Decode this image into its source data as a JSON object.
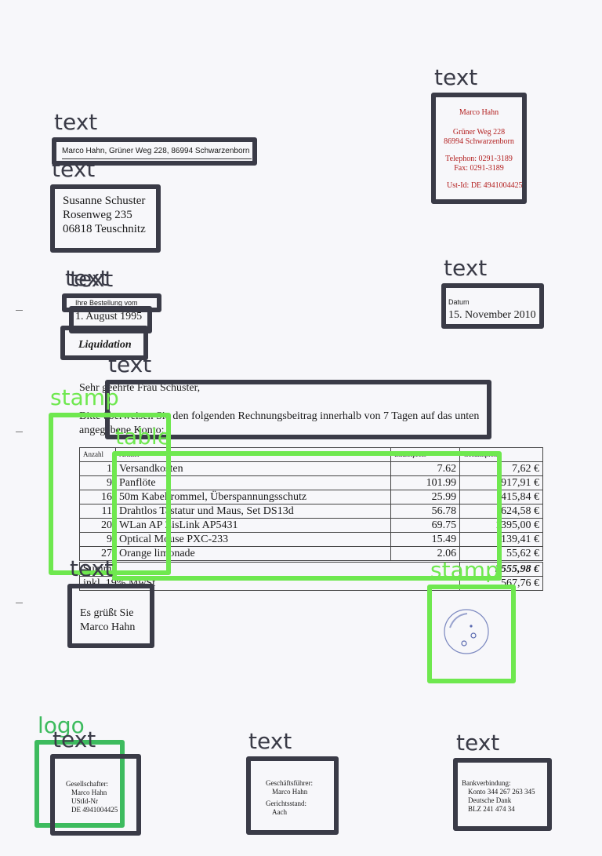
{
  "sender_line": "Marco Hahn, Grüner Weg 228, 86994 Schwarzenborn",
  "letterhead": {
    "name": "Marco Hahn",
    "street": "Grüner Weg 228",
    "city": "86994 Schwarzenborn",
    "phone": "Telephon:  0291-3189",
    "fax": "Fax:  0291-3189",
    "ustid": "Ust-Id: DE 4941004425"
  },
  "recipient": {
    "name": "Susanne Schuster",
    "street": "Rosenweg 235",
    "city": "06818 Teuschnitz"
  },
  "order_ref_label": "Ihre Bestellung vom",
  "order_date": "1. August 1995",
  "date_label": "Datum",
  "date_value": "15. November 2010",
  "subject": "Liquidation",
  "salutation": "Sehr geehrte Frau Schuster,",
  "body_line1": "Bitte überweisen Sie den folgenden Rechnungsbeitrag innerhalb von 7 Tagen auf das unten",
  "body_line2": "angegebene Konto:",
  "table": {
    "headers": [
      "Anzahl",
      "Artikel",
      "Einzelpreis",
      "Gesamtpreis"
    ],
    "rows": [
      {
        "qty": "1",
        "item": "Versandkosten",
        "unit": "7.62",
        "total": "7,62 €"
      },
      {
        "qty": "9",
        "item": "Panflöte",
        "unit": "101.99",
        "total": "917,91 €"
      },
      {
        "qty": "16",
        "item": "50m Kabeltrommel, Überspannungsschutz",
        "unit": "25.99",
        "total": "415,84 €"
      },
      {
        "qty": "11",
        "item": "Drahtlos Tastatur und Maus, Set DS13d",
        "unit": "56.78",
        "total": "624,58 €"
      },
      {
        "qty": "20",
        "item": "WLan AP ZisLink AP5431",
        "unit": "69.75",
        "total": "1395,00 €"
      },
      {
        "qty": "9",
        "item": "Optical Mouse PXC-233",
        "unit": "15.49",
        "total": "139,41 €"
      },
      {
        "qty": "27",
        "item": "Orange limonade",
        "unit": "2.06",
        "total": "55,62 €"
      }
    ],
    "sum_label": "Summe",
    "sum_value": "3555,98 €",
    "vat_label": "inkl. 19% MwSt",
    "vat_value": "567,76 €"
  },
  "closing": "Es grüßt Sie",
  "closing_name": "Marco Hahn",
  "footer_left": {
    "label": "Gesellschafter:",
    "name": "Marco Hahn",
    "ust_label": "UStId-Nr",
    "ust_value": "DE 4941004425"
  },
  "footer_mid": {
    "label": "Geschäftsführer:",
    "name": "Marco Hahn",
    "court_label": "Gerichtsstand:",
    "court_value": "Aach"
  },
  "footer_right": {
    "label": "Bankverbindung:",
    "account": "Konto 344 267 263 345",
    "bank": "Deutsche Dank",
    "blz": "BLZ 241 474 34"
  },
  "annotations": {
    "text": "text",
    "table": "table",
    "stamp": "stamp",
    "logo": "logo"
  },
  "colors": {
    "text_box": "#3a3b47",
    "table_stamp_box": "#6fe84f",
    "logo_box": "#3dbb5e",
    "letterhead_red": "#b32020"
  }
}
